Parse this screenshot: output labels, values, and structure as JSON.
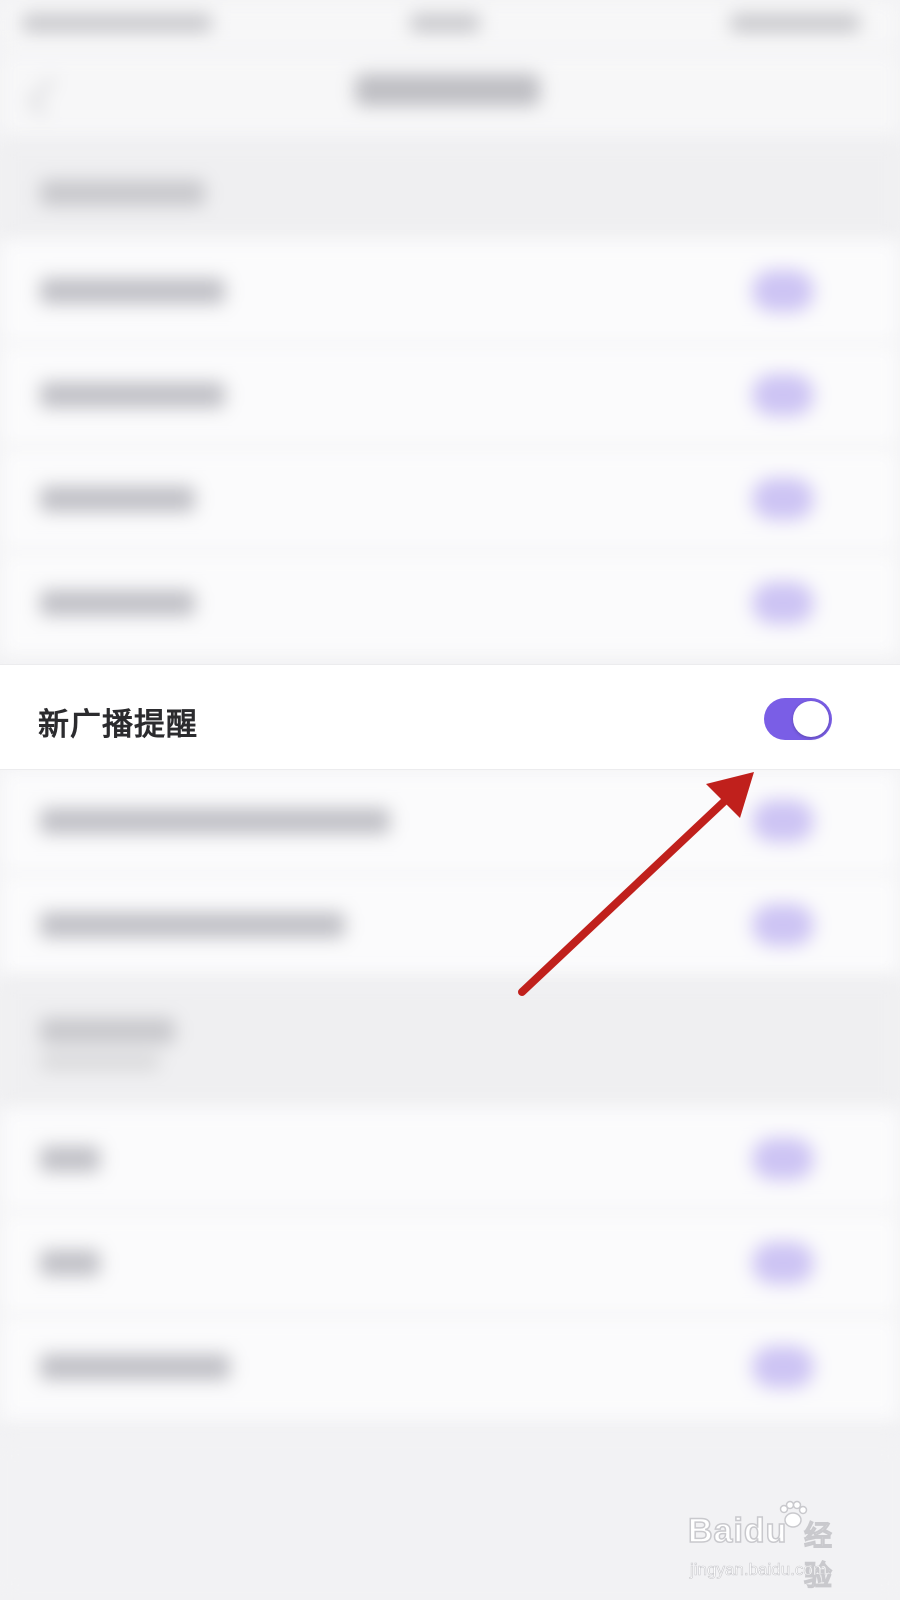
{
  "settings": {
    "new_broadcast_reminder": {
      "label": "新广播提醒",
      "enabled": true
    }
  },
  "colors": {
    "toggle_on": "#7a5ee6",
    "annotation_arrow": "#c0201c",
    "page_background": "#f2f2f4"
  },
  "watermark": {
    "logo_text": "Baidu",
    "cn_text": "经验",
    "url": "jingyan.baidu.com"
  }
}
